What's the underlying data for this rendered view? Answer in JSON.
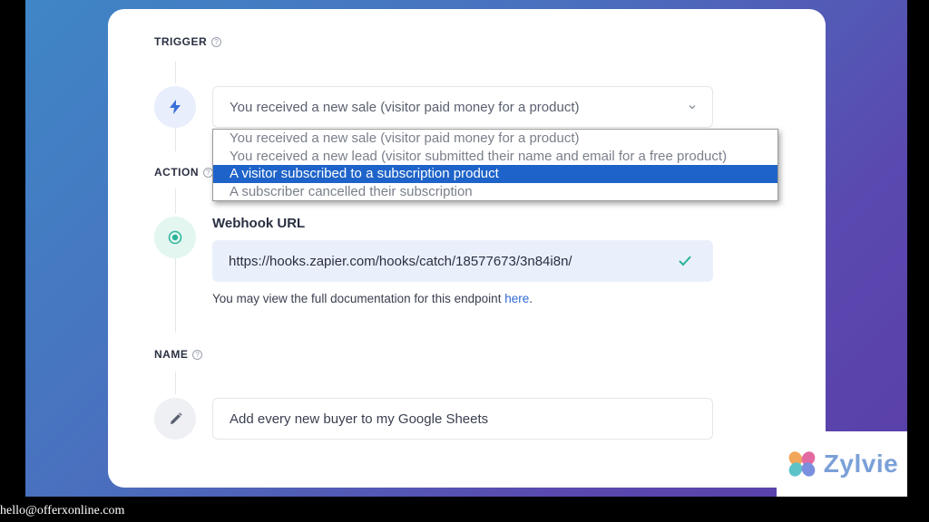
{
  "trigger": {
    "label": "TRIGGER",
    "selected_value": "You received a new sale (visitor paid money for a product)",
    "options": [
      "You received a new sale (visitor paid money for a product)",
      "You received a new lead (visitor submitted their name and email for a free product)",
      "A visitor subscribed to a subscription product",
      "A subscriber cancelled their subscription"
    ],
    "highlighted_option": "A visitor subscribed to a subscription product"
  },
  "action": {
    "label": "ACTION",
    "webhook_label": "Webhook URL",
    "webhook_url": "https://hooks.zapier.com/hooks/catch/18577673/3n84i8n/",
    "doc_text": "You may view the full documentation for this endpoint",
    "doc_link": "here",
    "doc_suffix": "."
  },
  "name": {
    "label": "NAME",
    "value": "Add every new buyer to my Google Sheets"
  },
  "help_glyph": "?",
  "watermark": {
    "brand": "Zylvie"
  },
  "footer": {
    "email": "hello@offerxonline.com"
  },
  "colors": {
    "accent": "#1e63c9",
    "link": "#2f6ad3",
    "check": "#2bb39a",
    "trigger_icon_bg": "#e8eefb",
    "action_icon_bg": "#e3f6f0",
    "name_icon_bg": "#eef0f4"
  },
  "icons": {
    "trigger": "lightning-bolt-icon",
    "action": "radio-target-icon",
    "name": "pencil-icon",
    "valid": "checkmark-icon",
    "dropdown": "chevron-down-icon"
  }
}
